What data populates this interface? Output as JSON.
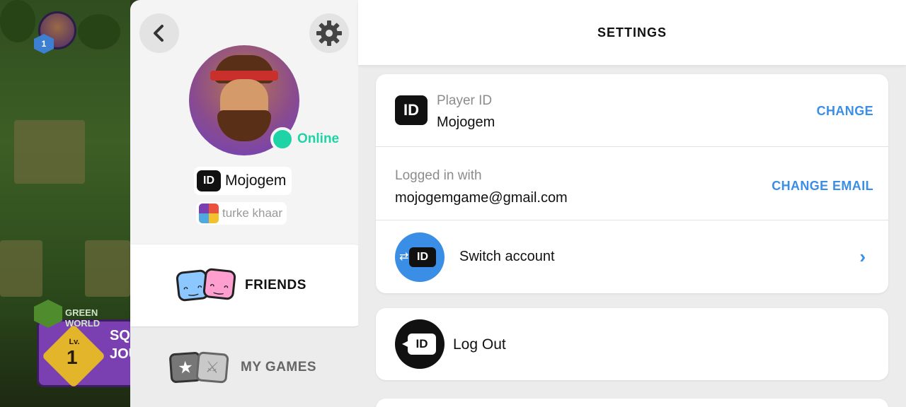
{
  "game": {
    "level_badge": "1",
    "world_label": "GREEN WORLD",
    "level_prefix": "Lv.",
    "level_number": "1",
    "world_title": "SQ\nJOU"
  },
  "profile": {
    "status": "Online",
    "player_name": "Mojogem",
    "id_badge": "ID",
    "team_name": "turke khaar"
  },
  "tabs": {
    "friends": "FRIENDS",
    "my_games": "MY GAMES"
  },
  "settings": {
    "title": "SETTINGS",
    "player_id_label": "Player ID",
    "player_id_value": "Mojogem",
    "change_label": "CHANGE",
    "logged_in_label": "Logged in with",
    "email": "mojogemgame@gmail.com",
    "change_email_label": "CHANGE EMAIL",
    "switch_account_label": "Switch account",
    "logout_label": "Log Out",
    "id_icon_text": "ID"
  },
  "colors": {
    "accent_blue": "#3a8ee6",
    "online_green": "#1ed4a6",
    "panel_bg": "#f4f4f4",
    "settings_bg": "#ececec"
  },
  "icons": {
    "back": "chevron-left-icon",
    "settings": "gear-icon",
    "switch": "switch-account-icon",
    "logout": "logout-icon",
    "chevron": "chevron-right-icon"
  }
}
